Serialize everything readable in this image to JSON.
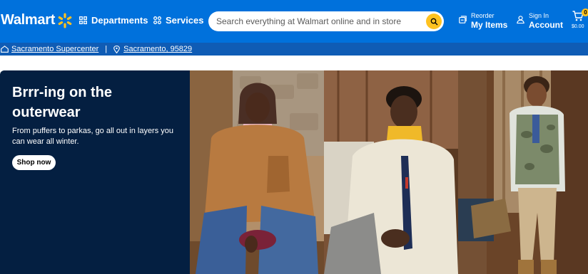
{
  "header": {
    "logo_text": "Walmart",
    "departments_label": "Departments",
    "services_label": "Services",
    "search_placeholder": "Search everything at Walmart online and in store",
    "reorder_small": "Reorder",
    "reorder_big": "My Items",
    "signin_small": "Sign In",
    "signin_big": "Account",
    "cart_count": "0",
    "cart_total": "$0.00"
  },
  "location": {
    "store": "Sacramento Supercenter",
    "separator": "|",
    "zip": "Sacramento, 95829"
  },
  "hero": {
    "title": "Brrr-ing on the outerwear",
    "subtitle": "From puffers to parkas, go all out in layers you can wear all winter.",
    "cta": "Shop now"
  },
  "colors": {
    "brand_blue": "#0071dc",
    "subbar_blue": "#0f5cb5",
    "spark_yellow": "#ffc220",
    "promo_navy": "#041f41"
  },
  "icons": [
    "spark-logo-icon",
    "grid-icon",
    "services-icon",
    "search-icon",
    "reorder-icon",
    "user-icon",
    "cart-icon",
    "store-icon",
    "location-pin-icon"
  ]
}
